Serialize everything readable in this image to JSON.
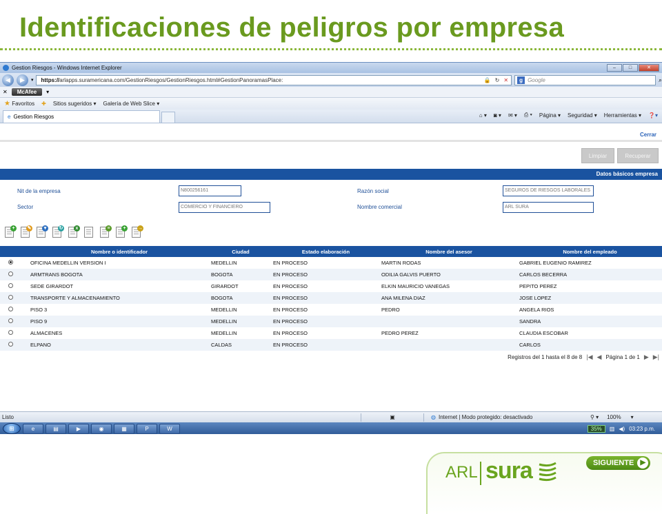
{
  "slide": {
    "title": "Identificaciones de peligros por empresa",
    "next_label": "SIGUIENTE",
    "logo_arl": "ARL",
    "logo_sura": "sura"
  },
  "browser": {
    "window_title": "Gestion Riesgos - Windows Internet Explorer",
    "url_scheme": "https://",
    "url_rest": "arlapps.suramericana.com/GestionRiesgos/GestionRiesgos.html#GestionPanoramasPlace:",
    "search_placeholder": "Google",
    "mcafee_label": "McAfee",
    "favorites_label": "Favoritos",
    "fav_links": [
      "Sitios sugeridos ▾",
      "Galería de Web Slice ▾"
    ],
    "tab_label": "Gestion Riesgos",
    "commands": [
      "Página ▾",
      "Seguridad ▾",
      "Herramientas ▾"
    ],
    "status_left": "Listo",
    "status_zone": "Internet | Modo protegido: desactivado",
    "zoom": "100%",
    "taskbar_battery": "35%",
    "taskbar_time": "03:23 p.m."
  },
  "app": {
    "close_label": "Cerrar",
    "clear_label": "Limpiar",
    "recover_label": "Recuperar",
    "section_title": "Datos básicos empresa",
    "fields": {
      "nit_label": "Nit de la empresa",
      "nit_value": "N800256161",
      "sector_label": "Sector",
      "sector_value": "COMERCIO Y FINANCIERO",
      "razon_label": "Razón social",
      "razon_value": "SEGUROS DE RIESGOS LABORALES",
      "nombre_label": "Nombre comercial",
      "nombre_value": "ARL SURA"
    },
    "toolbar_icons": [
      "add-doc-icon",
      "edit-doc-icon",
      "filter-doc-icon",
      "refresh-doc-icon",
      "excel-doc-icon",
      "list-doc-icon",
      "report-doc-icon",
      "add-row-icon",
      "export-doc-icon"
    ],
    "table": {
      "headers": [
        "Nombre o identificador",
        "Ciudad",
        "Estado elaboración",
        "Nombre del asesor",
        "Nombre del empleado"
      ],
      "rows": [
        {
          "selected": true,
          "nombre": "OFICINA MEDELLIN VERSION I",
          "ciudad": "MEDELLIN",
          "estado": "EN PROCESO",
          "asesor": "MARTIN RODAS",
          "empleado": "GABRIEL EUGENIO RAMIREZ"
        },
        {
          "selected": false,
          "nombre": "ARMTRANS BOGOTA",
          "ciudad": "BOGOTA",
          "estado": "EN PROCESO",
          "asesor": "ODILIA GALVIS PUERTO",
          "empleado": "CARLOS BECERRA"
        },
        {
          "selected": false,
          "nombre": "SEDE GIRARDOT",
          "ciudad": "GIRARDOT",
          "estado": "EN PROCESO",
          "asesor": "ELKIN MAURICIO VANEGAS",
          "empleado": "PEPITO PEREZ"
        },
        {
          "selected": false,
          "nombre": "TRANSPORTE Y ALMACENAMIENTO",
          "ciudad": "BOGOTA",
          "estado": "EN PROCESO",
          "asesor": "ANA MILENA DIAZ",
          "empleado": "JOSE LOPEZ"
        },
        {
          "selected": false,
          "nombre": "PISO 3",
          "ciudad": "MEDELLIN",
          "estado": "EN PROCESO",
          "asesor": "PEDRO",
          "empleado": "ANGELA RIOS"
        },
        {
          "selected": false,
          "nombre": "PISO 9",
          "ciudad": "MEDELLIN",
          "estado": "EN PROCESO",
          "asesor": "",
          "empleado": "SANDRA"
        },
        {
          "selected": false,
          "nombre": "ALMACENES",
          "ciudad": "MEDELLIN",
          "estado": "EN PROCESO",
          "asesor": "PEDRO PEREZ",
          "empleado": "CLAUDIA ESCOBAR"
        },
        {
          "selected": false,
          "nombre": "ELPANO",
          "ciudad": "CALDAS",
          "estado": "EN PROCESO",
          "asesor": "",
          "empleado": "CARLOS"
        }
      ]
    },
    "pager": {
      "records": "Registros del 1 hasta el 8 de 8",
      "page": "Página 1 de 1"
    }
  },
  "colors": {
    "title_green": "#6a9a1f",
    "grid_header_blue": "#1a53a0",
    "label_blue": "#1f4f97"
  }
}
